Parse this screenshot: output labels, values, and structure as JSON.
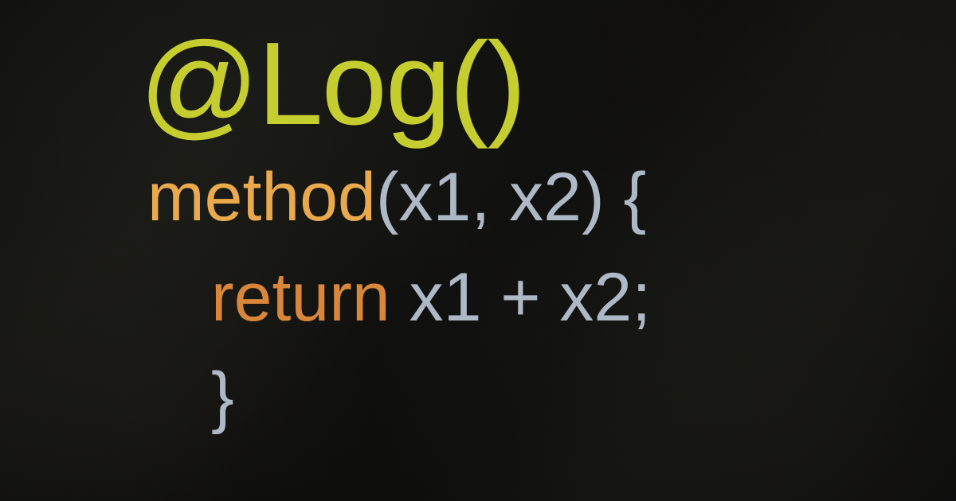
{
  "code": {
    "decorator": "@Log()",
    "method_name": "method",
    "params_signature": "(x1, x2) {",
    "return_keyword": "return",
    "expression": " x1 + x2;",
    "closing_brace": "}"
  },
  "colors": {
    "decorator": "#c5ce2e",
    "method": "#e9a94d",
    "params": "#aeb9c7",
    "keyword": "#d8873a",
    "background": "#0a0a0a"
  }
}
